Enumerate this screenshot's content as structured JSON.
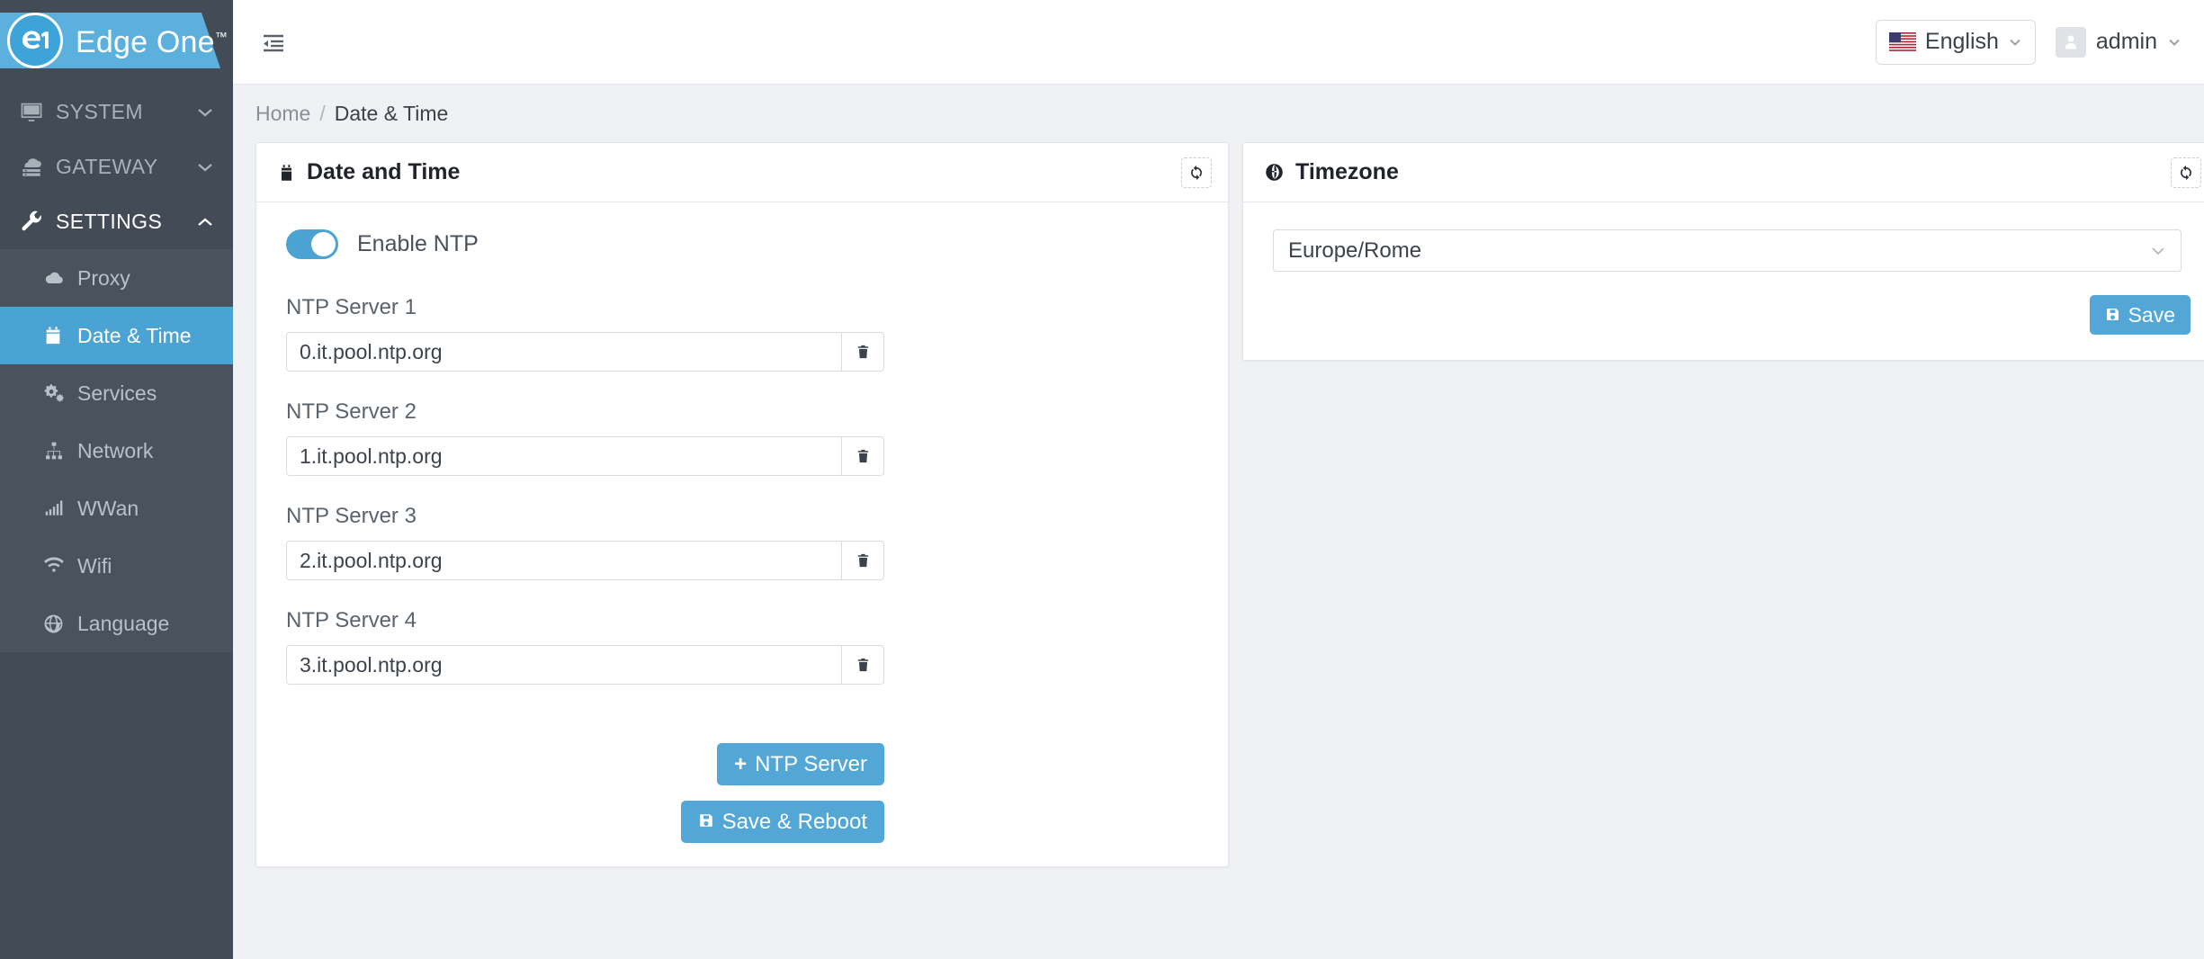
{
  "brand": {
    "name": "Edge One",
    "tm": "™",
    "logo_icon": "e1-monogram-logo",
    "banner_color": "#5cb0dd",
    "badge_color": "#3ea3d9"
  },
  "sidebar": {
    "background": "#434c56",
    "submenu_background": "#4a535d",
    "active_color": "#4ba3d3",
    "groups": [
      {
        "label": "SYSTEM",
        "icon": "monitor-icon",
        "expanded": false,
        "caret": "chevron-down-icon"
      },
      {
        "label": "GATEWAY",
        "icon": "server-cloud-icon",
        "expanded": false,
        "caret": "chevron-down-icon"
      },
      {
        "label": "SETTINGS",
        "icon": "wrench-icon",
        "expanded": true,
        "caret": "chevron-up-icon"
      }
    ],
    "items": [
      {
        "label": "Proxy",
        "icon": "cloud-icon",
        "selected": false
      },
      {
        "label": "Date & Time",
        "icon": "calendar-icon",
        "selected": true
      },
      {
        "label": "Services",
        "icon": "gears-icon",
        "selected": false
      },
      {
        "label": "Network",
        "icon": "sitemap-icon",
        "selected": false
      },
      {
        "label": "WWan",
        "icon": "signal-bars-icon",
        "selected": false
      },
      {
        "label": "Wifi",
        "icon": "wifi-icon",
        "selected": false
      },
      {
        "label": "Language",
        "icon": "globe-icon",
        "selected": false
      }
    ]
  },
  "topbar": {
    "collapse_icon": "sidebar-collapse-icon",
    "language": {
      "label": "English",
      "flag_icon": "us-flag-icon",
      "caret": "chevron-down-icon"
    },
    "user": {
      "label": "admin",
      "avatar_icon": "user-icon",
      "caret": "chevron-down-icon"
    }
  },
  "breadcrumb": {
    "home": "Home",
    "separator": "/",
    "current": "Date & Time"
  },
  "date_time_card": {
    "title": "Date and Time",
    "title_icon": "calendar-icon",
    "refresh_icon": "refresh-icon",
    "ntp_toggle": {
      "label": "Enable NTP",
      "enabled": true
    },
    "servers": [
      {
        "label": "NTP Server 1",
        "value": "0.it.pool.ntp.org",
        "placeholder": "NTP Server",
        "delete_icon": "trash-icon"
      },
      {
        "label": "NTP Server 2",
        "value": "1.it.pool.ntp.org",
        "placeholder": "NTP Server",
        "delete_icon": "trash-icon"
      },
      {
        "label": "NTP Server 3",
        "value": "2.it.pool.ntp.org",
        "placeholder": "NTP Server",
        "delete_icon": "trash-icon"
      },
      {
        "label": "NTP Server 4",
        "value": "3.it.pool.ntp.org",
        "placeholder": "NTP Server",
        "delete_icon": "trash-icon"
      }
    ],
    "add_button": {
      "label": "NTP Server",
      "prefix": "+"
    },
    "save_button": {
      "label": "Save & Reboot",
      "icon": "save-icon"
    }
  },
  "timezone_card": {
    "title": "Timezone",
    "title_icon": "globe-icon",
    "refresh_icon": "refresh-icon",
    "select": {
      "value": "Europe/Rome",
      "caret": "chevron-down-icon"
    },
    "save_button": {
      "label": "Save",
      "icon": "save-icon"
    }
  },
  "colors": {
    "accent": "#52a7d6",
    "page_bg": "#eff1f5",
    "card_bg": "#ffffff",
    "text": "#3c434b"
  }
}
